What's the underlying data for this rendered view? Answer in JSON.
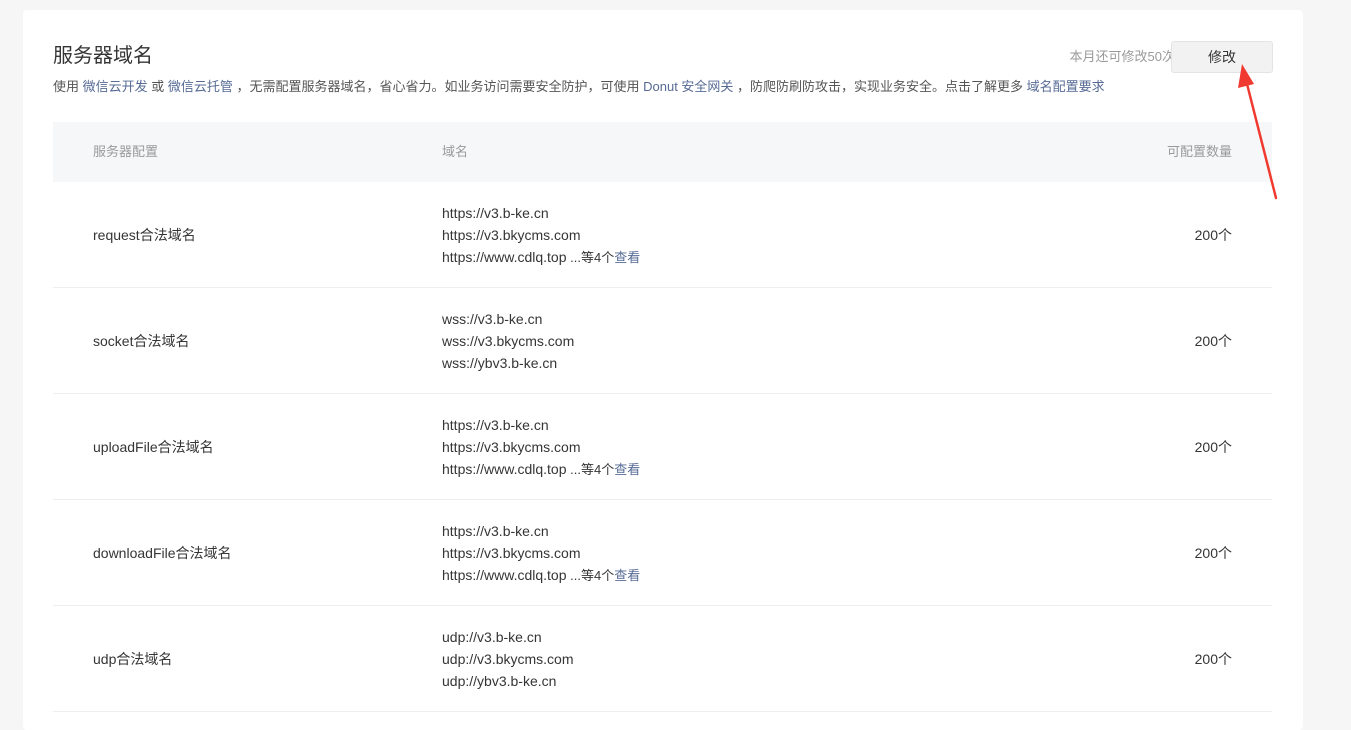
{
  "header": {
    "title": "服务器域名",
    "quota_text": "本月还可修改50次",
    "modify_label": "修改"
  },
  "description": {
    "part1": "使用 ",
    "link1": "微信云开发",
    "part2": " 或 ",
    "link2": "微信云托管",
    "part3": " ，无需配置服务器域名，省心省力。如业务访问需要安全防护，可使用 ",
    "link3": "Donut 安全网关",
    "part4": " ，防爬防刷防攻击，实现业务安全。点击了解更多 ",
    "link4": "域名配置要求"
  },
  "table": {
    "headers": {
      "config": "服务器配置",
      "domain": "域名",
      "count": "可配置数量"
    },
    "rows": [
      {
        "name": "request合法域名",
        "domains": [
          "https://v3.b-ke.cn",
          "https://v3.bkycms.com",
          "https://www.cdlq.top"
        ],
        "more_text": " ...等4个",
        "more_link": "查看",
        "count": "200个"
      },
      {
        "name": "socket合法域名",
        "domains": [
          "wss://v3.b-ke.cn",
          "wss://v3.bkycms.com",
          "wss://ybv3.b-ke.cn"
        ],
        "count": "200个"
      },
      {
        "name": "uploadFile合法域名",
        "domains": [
          "https://v3.b-ke.cn",
          "https://v3.bkycms.com",
          "https://www.cdlq.top"
        ],
        "more_text": " ...等4个",
        "more_link": "查看",
        "count": "200个"
      },
      {
        "name": "downloadFile合法域名",
        "domains": [
          "https://v3.b-ke.cn",
          "https://v3.bkycms.com",
          "https://www.cdlq.top"
        ],
        "more_text": " ...等4个",
        "more_link": "查看",
        "count": "200个"
      },
      {
        "name": "udp合法域名",
        "domains": [
          "udp://v3.b-ke.cn",
          "udp://v3.bkycms.com",
          "udp://ybv3.b-ke.cn"
        ],
        "count": "200个"
      }
    ]
  },
  "colors": {
    "link": "#576b95",
    "arrow": "#f03a2f"
  }
}
